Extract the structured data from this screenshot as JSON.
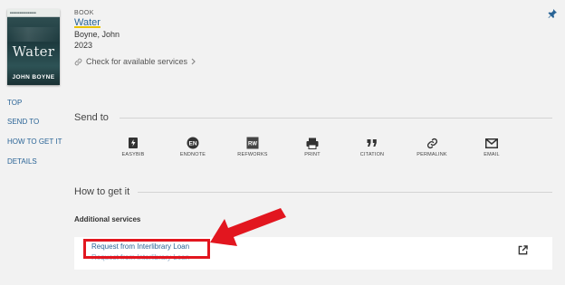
{
  "record": {
    "type": "BOOK",
    "title": "Water",
    "author": "Boyne, John",
    "year": "2023",
    "check_services": "Check for available services",
    "cover": {
      "title_text": "Water",
      "author_text": "JOHN BOYNE"
    }
  },
  "nav": {
    "items": [
      "TOP",
      "SEND TO",
      "HOW TO GET IT",
      "DETAILS"
    ]
  },
  "send_to": {
    "heading": "Send to",
    "actions": [
      {
        "label": "EASYBIB",
        "icon": "easybib-icon"
      },
      {
        "label": "ENDNOTE",
        "icon": "endnote-icon"
      },
      {
        "label": "REFWORKS",
        "icon": "refworks-icon"
      },
      {
        "label": "PRINT",
        "icon": "print-icon"
      },
      {
        "label": "CITATION",
        "icon": "citation-icon"
      },
      {
        "label": "PERMALINK",
        "icon": "permalink-icon"
      },
      {
        "label": "EMAIL",
        "icon": "email-icon"
      }
    ],
    "endnote_badge": "EN",
    "refworks_badge": "RW"
  },
  "how_to_get": {
    "heading": "How to get it",
    "additional_services": "Additional services",
    "request_link": "Request from Interlibrary Loan",
    "request_sub": "Request from Interlibrary Loan"
  },
  "colors": {
    "link": "#2a6496",
    "highlight": "#e2161f",
    "background": "#f2f2f2"
  }
}
